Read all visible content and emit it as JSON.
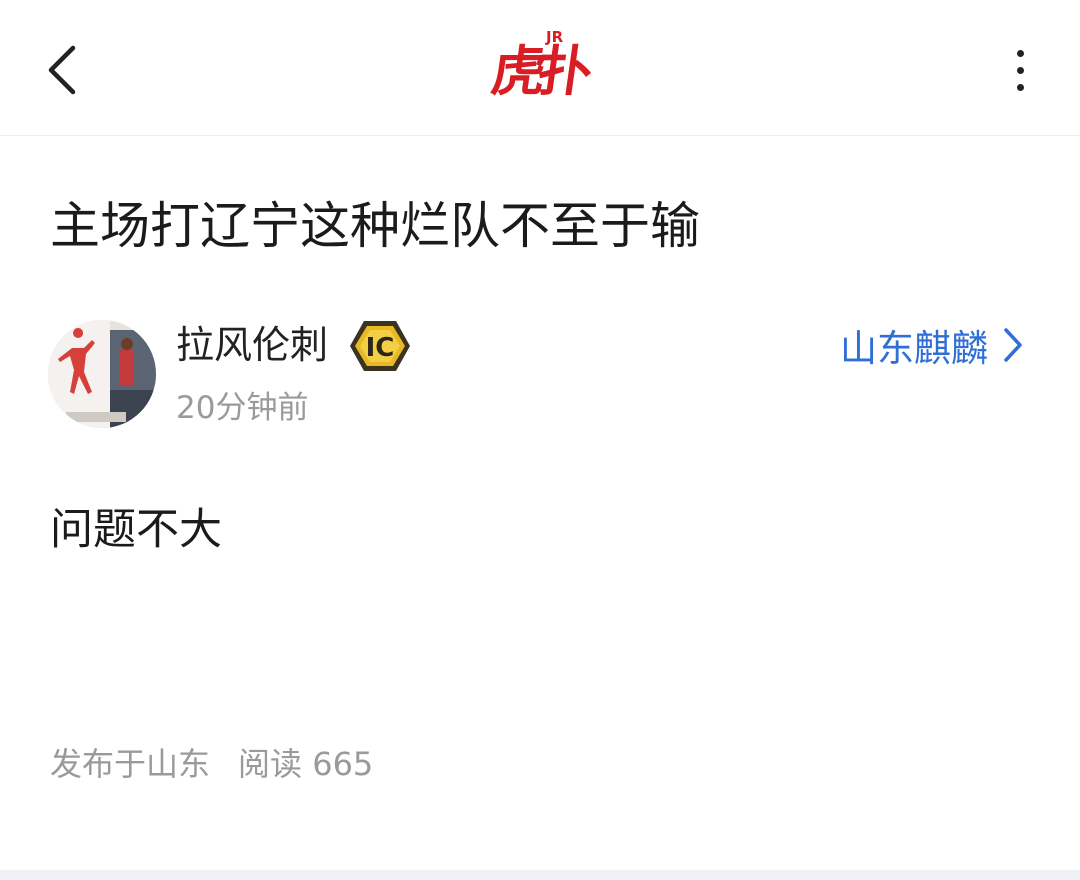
{
  "header": {
    "back_icon": "chevron-left-icon",
    "logo_superscript": "JR",
    "logo_text": "虎扑",
    "more_icon": "vertical-ellipsis-icon"
  },
  "post": {
    "title": "主场打辽宁这种烂队不至于输",
    "author": {
      "name": "拉风伦刺",
      "badge_text": "IC",
      "time": "20分钟前"
    },
    "team_link": {
      "label": "山东麒麟",
      "icon": "chevron-right-icon"
    },
    "body": "问题不大",
    "meta": {
      "location": "发布于山东",
      "reads_label": "阅读",
      "reads_count": "665"
    }
  },
  "colors": {
    "brand_red": "#d81e24",
    "link_blue": "#2f6fd6",
    "muted_gray": "#9a9a9a",
    "badge_gold": "#e8b923"
  }
}
